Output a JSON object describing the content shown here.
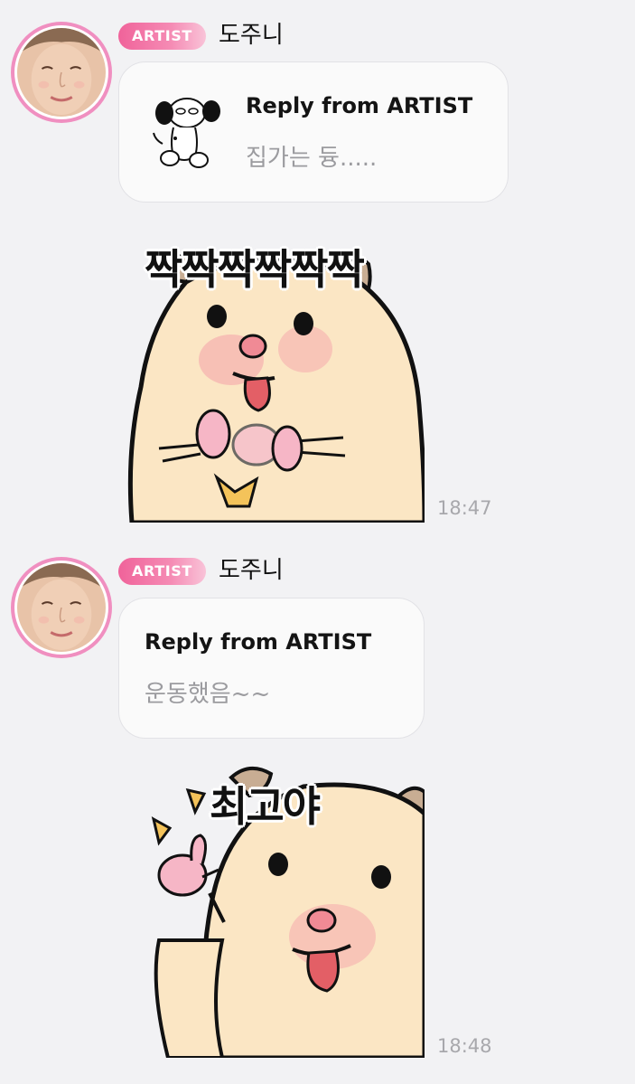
{
  "messages": [
    {
      "badge": "ARTIST",
      "author": "도주니",
      "reply_title": "Reply from ARTIST",
      "reply_text": "집가는 듕.....",
      "sticker_caption": "짝짝짝짝짝짝",
      "time": "18:47"
    },
    {
      "badge": "ARTIST",
      "author": "도주니",
      "reply_title": "Reply from ARTIST",
      "reply_text": "운동했음~~",
      "sticker_caption": "최고야",
      "time": "18:48"
    }
  ]
}
